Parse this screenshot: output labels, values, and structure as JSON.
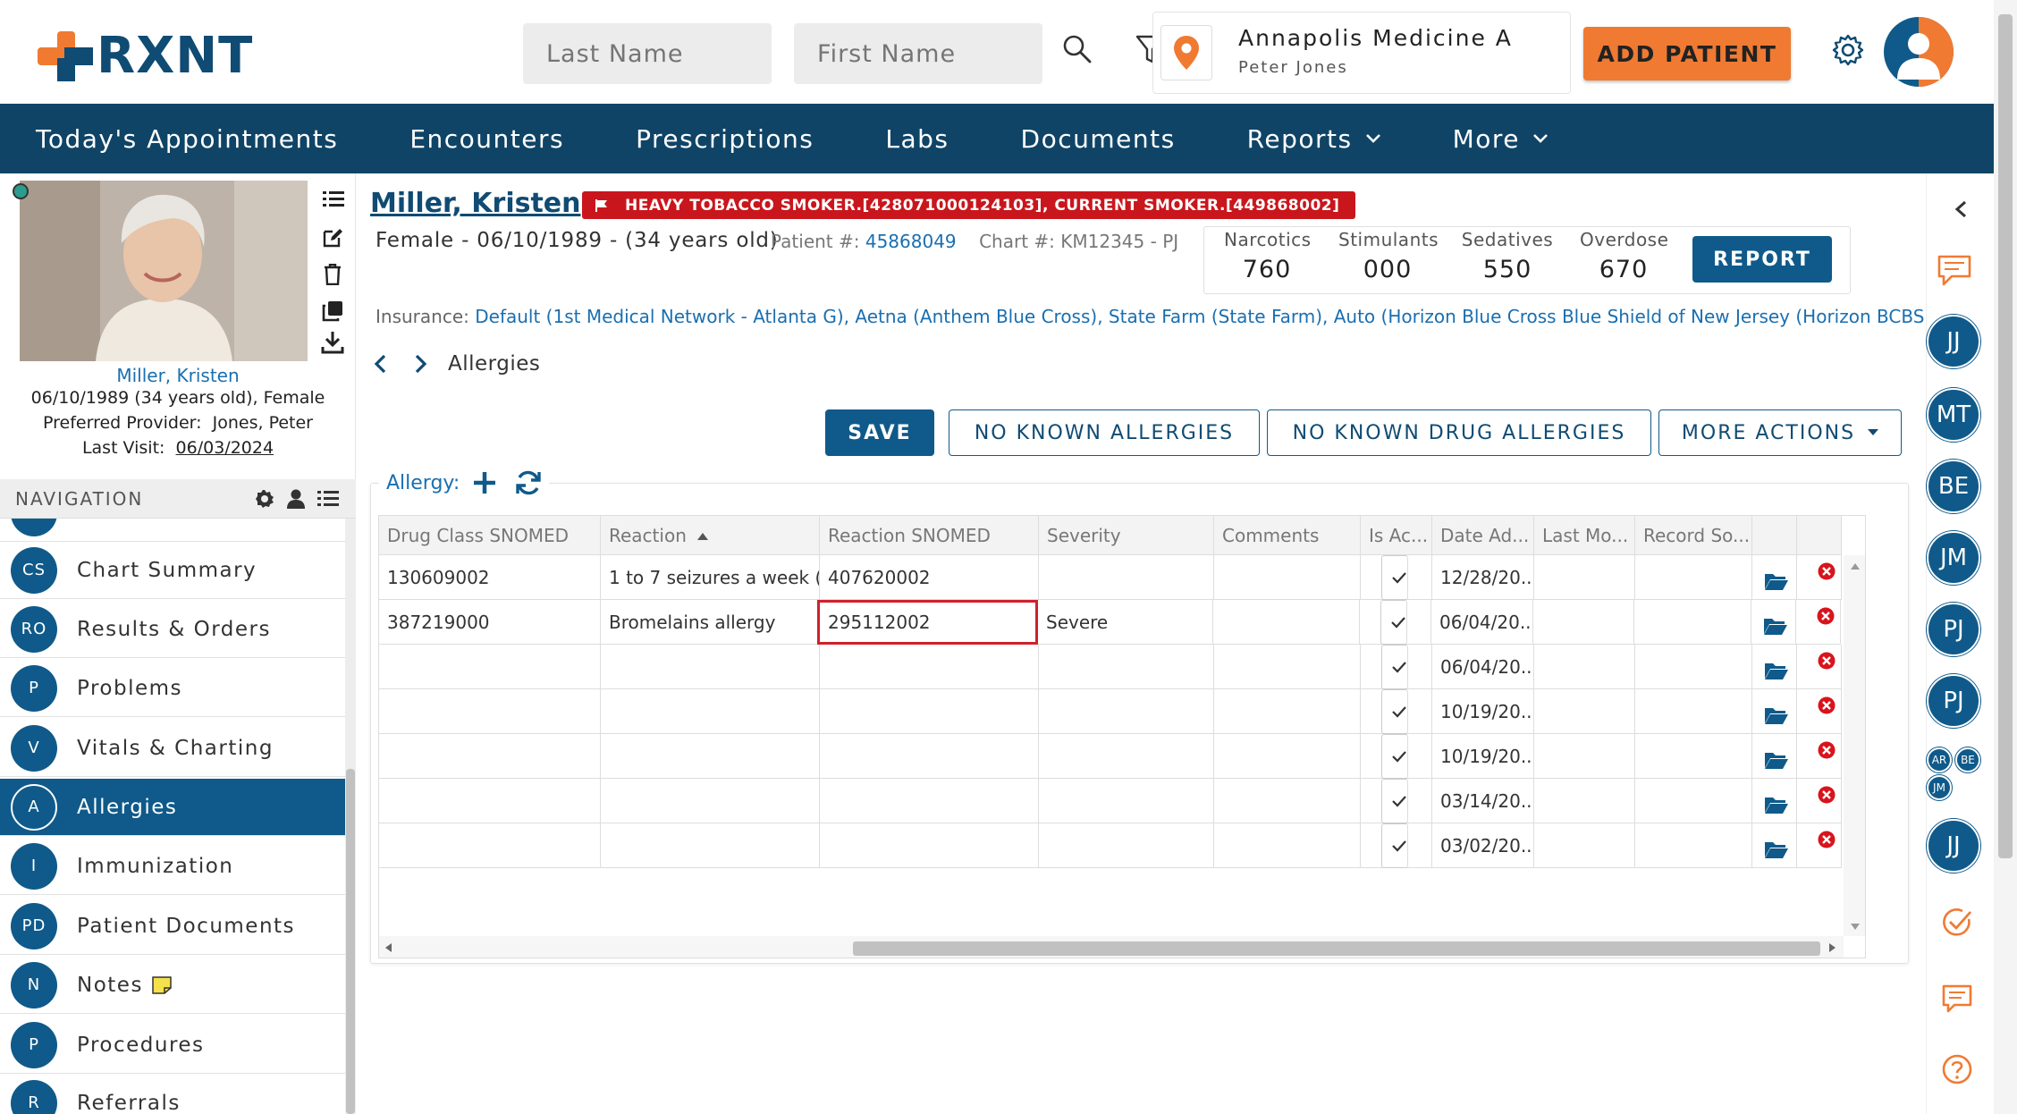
{
  "header": {
    "logo_text": "RXNT",
    "last_name_placeholder": "Last Name",
    "first_name_placeholder": "First Name",
    "location_name": "Annapolis Medicine A",
    "location_provider": "Peter Jones",
    "add_patient_label": "ADD PATIENT",
    "accent_color": "#f07a32",
    "brand_color": "#0f4466"
  },
  "nav": {
    "items": [
      {
        "label": "Today's Appointments"
      },
      {
        "label": "Encounters"
      },
      {
        "label": "Prescriptions"
      },
      {
        "label": "Labs"
      },
      {
        "label": "Documents"
      },
      {
        "label": "Reports",
        "dropdown": true
      },
      {
        "label": "More",
        "dropdown": true
      }
    ]
  },
  "patient_card": {
    "name": "Miller, Kristen",
    "dob_gender": "06/10/1989 (34 years old), Female",
    "preferred_provider_label": "Preferred Provider:",
    "preferred_provider": "Jones, Peter",
    "last_visit_label": "Last Visit:",
    "last_visit": "06/03/2024"
  },
  "sidebar": {
    "title": "NAVIGATION",
    "items": [
      {
        "abbr": "CS",
        "label": "Chart Summary"
      },
      {
        "abbr": "RO",
        "label": "Results & Orders"
      },
      {
        "abbr": "P",
        "label": "Problems"
      },
      {
        "abbr": "V",
        "label": "Vitals & Charting"
      },
      {
        "abbr": "A",
        "label": "Allergies",
        "active": true
      },
      {
        "abbr": "I",
        "label": "Immunization"
      },
      {
        "abbr": "PD",
        "label": "Patient Documents"
      },
      {
        "abbr": "N",
        "label": "Notes"
      },
      {
        "abbr": "P",
        "label": "Procedures"
      },
      {
        "abbr": "R",
        "label": "Referrals"
      }
    ]
  },
  "patient": {
    "name": "Miller, Kristen",
    "alert": "HEAVY TOBACCO SMOKER.[428071000124103], CURRENT SMOKER.[449868002]",
    "demographics": "Female - 06/10/1989 - (34 years old)",
    "patient_num_label": "Patient #:",
    "patient_num": "45868049",
    "chart_label": "Chart #: KM12345 - PJ",
    "insurance_label": "Insurance:",
    "insurance": "Default (1st Medical Network - Atlanta G), Aetna (Anthem Blue Cross), State Farm (State Farm), Auto (Horizon Blue Cross Blue Shield of New Jersey (Horizon BCBSNJ)), HI_P ('Nova"
  },
  "counters": [
    {
      "label": "Narcotics",
      "value": "760"
    },
    {
      "label": "Stimulants",
      "value": "000"
    },
    {
      "label": "Sedatives",
      "value": "550"
    },
    {
      "label": "Overdose",
      "value": "670"
    }
  ],
  "report_label": "REPORT",
  "breadcrumb": "Allergies",
  "actions": {
    "save": "SAVE",
    "no_known_allergies": "NO KNOWN ALLERGIES",
    "no_known_drug_allergies": "NO KNOWN DRUG ALLERGIES",
    "more_actions": "MORE ACTIONS"
  },
  "allergy_label": "Allergy:",
  "table": {
    "columns": [
      "Drug Class SNOMED",
      "Reaction",
      "Reaction SNOMED",
      "Severity",
      "Comments",
      "Is Ac...",
      "Date Ad...",
      "Last Mo...",
      "Record So..."
    ],
    "sorted_column": "Reaction",
    "rows": [
      {
        "drug_class": "130609002",
        "reaction": "1 to 7 seizures a week (...",
        "reaction_snomed": "407620002",
        "severity": "",
        "comments": "",
        "active": true,
        "date_added": "12/28/20...",
        "last_mod": "",
        "record_src": ""
      },
      {
        "drug_class": "387219000",
        "reaction": "Bromelains allergy",
        "reaction_snomed": "295112002",
        "severity": "Severe",
        "comments": "",
        "active": true,
        "date_added": "06/04/20...",
        "last_mod": "",
        "record_src": "",
        "editing": true
      },
      {
        "drug_class": "",
        "reaction": "",
        "reaction_snomed": "",
        "severity": "",
        "comments": "",
        "active": true,
        "date_added": "06/04/20...",
        "last_mod": "",
        "record_src": ""
      },
      {
        "drug_class": "",
        "reaction": "",
        "reaction_snomed": "",
        "severity": "",
        "comments": "",
        "active": true,
        "date_added": "10/19/20...",
        "last_mod": "",
        "record_src": ""
      },
      {
        "drug_class": "",
        "reaction": "",
        "reaction_snomed": "",
        "severity": "",
        "comments": "",
        "active": true,
        "date_added": "10/19/20...",
        "last_mod": "",
        "record_src": ""
      },
      {
        "drug_class": "",
        "reaction": "",
        "reaction_snomed": "",
        "severity": "",
        "comments": "",
        "active": true,
        "date_added": "03/14/20...",
        "last_mod": "",
        "record_src": ""
      },
      {
        "drug_class": "",
        "reaction": "",
        "reaction_snomed": "",
        "severity": "",
        "comments": "",
        "active": true,
        "date_added": "03/02/20...",
        "last_mod": "",
        "record_src": ""
      }
    ]
  },
  "right_rail": {
    "avatars": [
      "JJ",
      "MT",
      "BE",
      "JM",
      "PJ",
      "PJ",
      "JJ"
    ],
    "small_avatars": [
      "AR",
      "BE",
      "JM"
    ]
  }
}
